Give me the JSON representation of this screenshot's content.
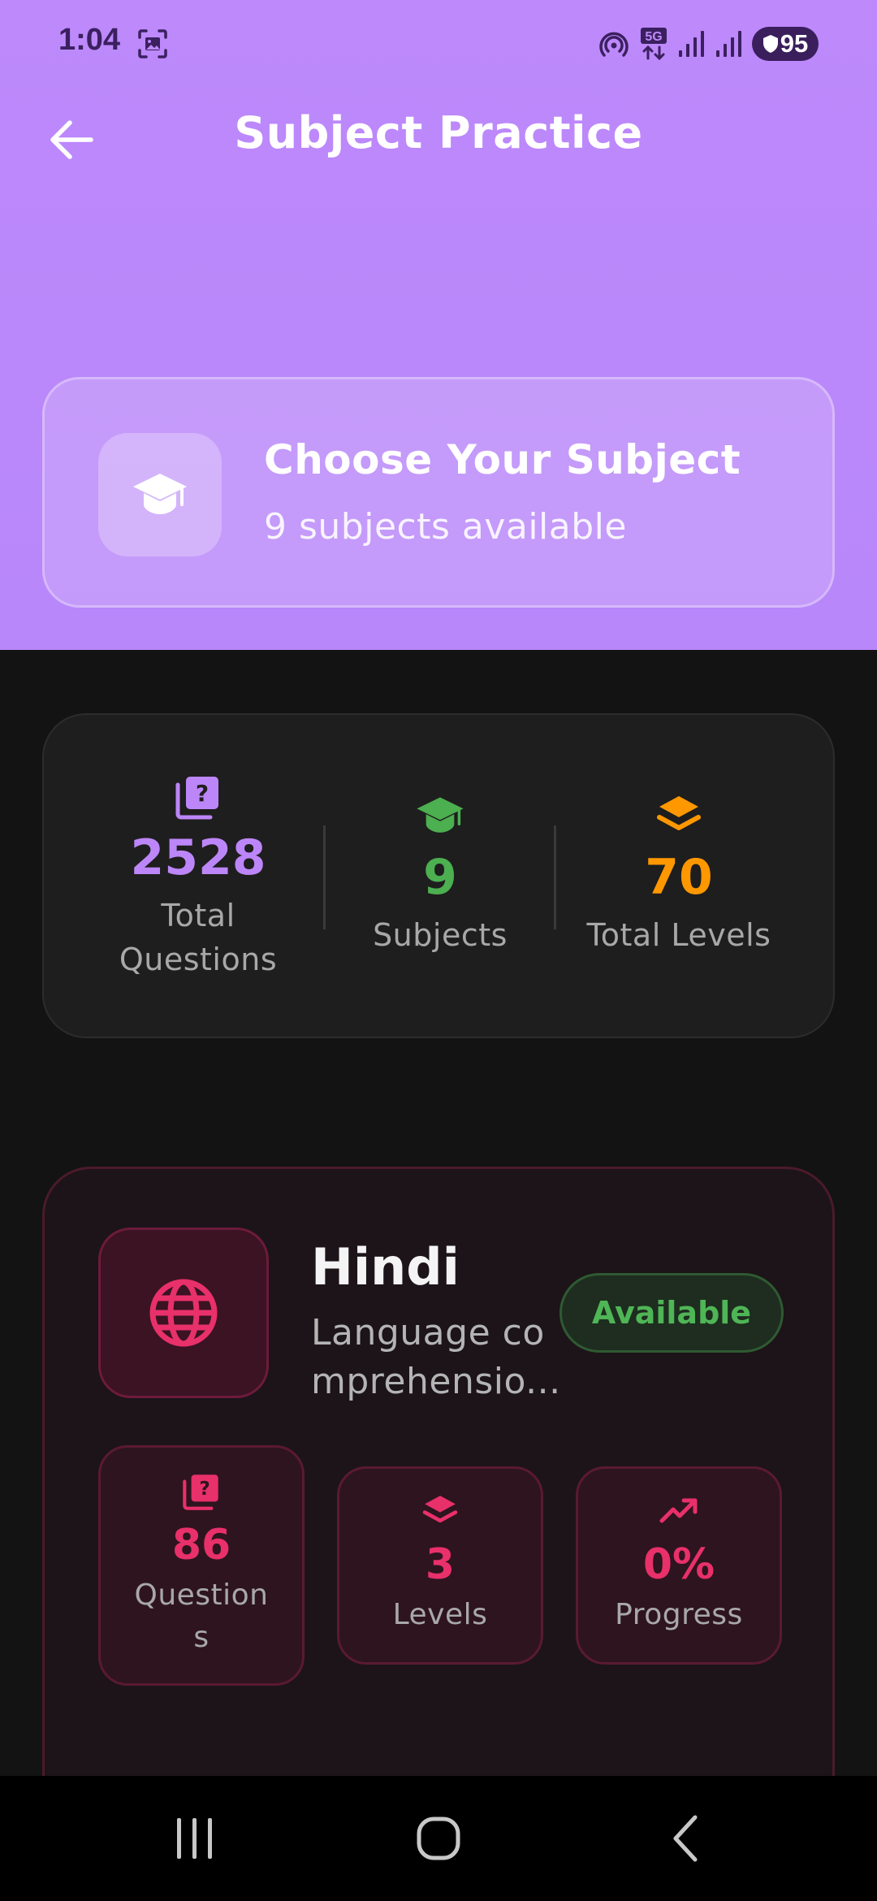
{
  "status_bar": {
    "time": "1:04",
    "battery": "95",
    "network": "5G"
  },
  "header": {
    "title": "Subject Practice",
    "back_icon": "arrow-left-icon"
  },
  "choose_card": {
    "title": "Choose Your Subject",
    "subtitle": "9 subjects available",
    "icon": "graduation-cap-icon"
  },
  "stats": {
    "items": [
      {
        "value": "2528",
        "label": "Total Questions",
        "icon": "question-stack-icon",
        "color": "#bd86f8"
      },
      {
        "value": "9",
        "label": "Subjects",
        "icon": "graduation-cap-icon",
        "color": "#4caf50"
      },
      {
        "value": "70",
        "label": "Total Levels",
        "icon": "layers-icon",
        "color": "#ff9800"
      }
    ]
  },
  "subjects": [
    {
      "name": "Hindi",
      "description": "Language comprehensio...",
      "status": "Available",
      "icon": "globe-icon",
      "accent": "#e8306a",
      "stats": [
        {
          "value": "86",
          "label": "Questions",
          "icon": "question-stack-icon"
        },
        {
          "value": "3",
          "label": "Levels",
          "icon": "layers-icon"
        },
        {
          "value": "0%",
          "label": "Progress",
          "icon": "trending-up-icon"
        }
      ]
    }
  ],
  "colors": {
    "header_purple": "#bd89fb",
    "background": "#131313",
    "available_green": "#4fb556"
  },
  "nav": {
    "recents_icon": "recents-icon",
    "home_icon": "home-icon",
    "back_icon": "nav-back-icon"
  }
}
